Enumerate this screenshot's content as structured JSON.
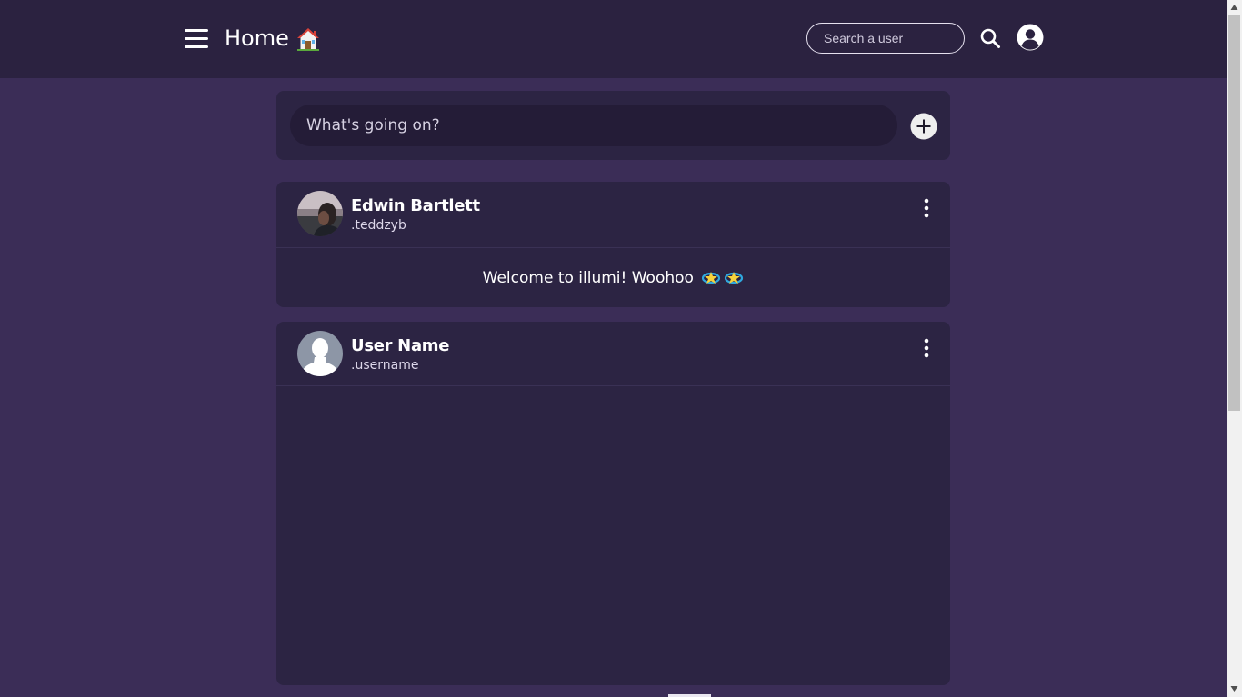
{
  "header": {
    "title": "Home",
    "menu_icon": "hamburger-menu-icon",
    "title_icon": "house-emoji-icon",
    "search": {
      "placeholder": "Search a user"
    },
    "search_icon": "search-icon",
    "profile_icon": "user-circle-icon"
  },
  "composer": {
    "placeholder": "What's going on?",
    "add_icon": "plus-circle-icon"
  },
  "posts": [
    {
      "author": "Edwin Bartlett",
      "handle": ".teddzyb",
      "text": "Welcome to illumi! Woohoo",
      "emoji": "sparkle-ring-emoji",
      "avatar": "photo"
    },
    {
      "author": "User Name",
      "handle": ".username",
      "text": "",
      "avatar": "default-silhouette"
    }
  ],
  "colors": {
    "page_bg": "#3b2d57",
    "header_bg": "#2b2240",
    "card_bg": "#2c2443",
    "input_bg": "#241c37",
    "accent": "#3d7fd6"
  }
}
